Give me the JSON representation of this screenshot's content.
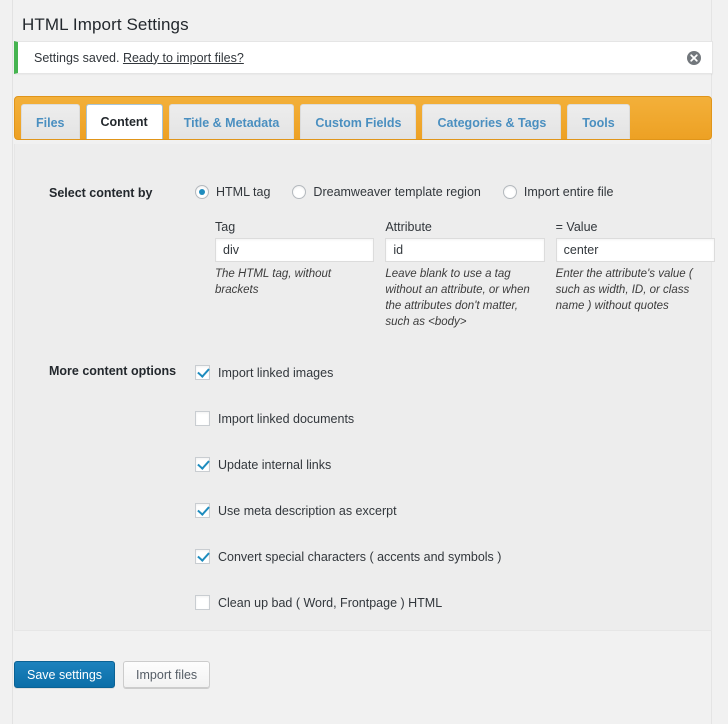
{
  "page": {
    "title": "HTML Import Settings"
  },
  "notice": {
    "message": "Settings saved.",
    "link_text": "Ready to import files?",
    "dismiss_icon": "close-circle-icon"
  },
  "tabs": [
    {
      "label": "Files",
      "active": false
    },
    {
      "label": "Content",
      "active": true
    },
    {
      "label": "Title & Metadata",
      "active": false
    },
    {
      "label": "Custom Fields",
      "active": false
    },
    {
      "label": "Categories & Tags",
      "active": false
    },
    {
      "label": "Tools",
      "active": false
    }
  ],
  "select_content_by": {
    "label": "Select content by",
    "options": [
      {
        "label": "HTML tag",
        "checked": true
      },
      {
        "label": "Dreamweaver template region",
        "checked": false
      },
      {
        "label": "Import entire file",
        "checked": false
      }
    ]
  },
  "fields": [
    {
      "label": "Tag",
      "value": "div",
      "placeholder": "",
      "help": "The HTML tag, without brackets"
    },
    {
      "label": "Attribute",
      "value": "id",
      "placeholder": "",
      "help": "Leave blank to use a tag without an attribute, or when the attributes don't matter, such as <body>"
    },
    {
      "label": "= Value",
      "value": "center",
      "placeholder": "",
      "help": "Enter the attribute's value ( such as width, ID, or class name ) without quotes"
    }
  ],
  "more_content_options": {
    "label": "More content options",
    "options": [
      {
        "label": "Import linked images",
        "checked": true
      },
      {
        "label": "Import linked documents",
        "checked": false
      },
      {
        "label": "Update internal links",
        "checked": true
      },
      {
        "label": "Use meta description as excerpt",
        "checked": true
      },
      {
        "label": "Convert special characters ( accents and symbols )",
        "checked": true
      },
      {
        "label": "Clean up bad ( Word, Frontpage ) HTML",
        "checked": false
      }
    ]
  },
  "footer": {
    "save_label": "Save settings",
    "import_label": "Import files"
  },
  "colors": {
    "tab_bar": "#f0a828",
    "notice_accent": "#46b450",
    "accent_blue": "#1e8cbe",
    "primary_button": "#0d74b0",
    "tab_link": "#4a8fc0"
  }
}
